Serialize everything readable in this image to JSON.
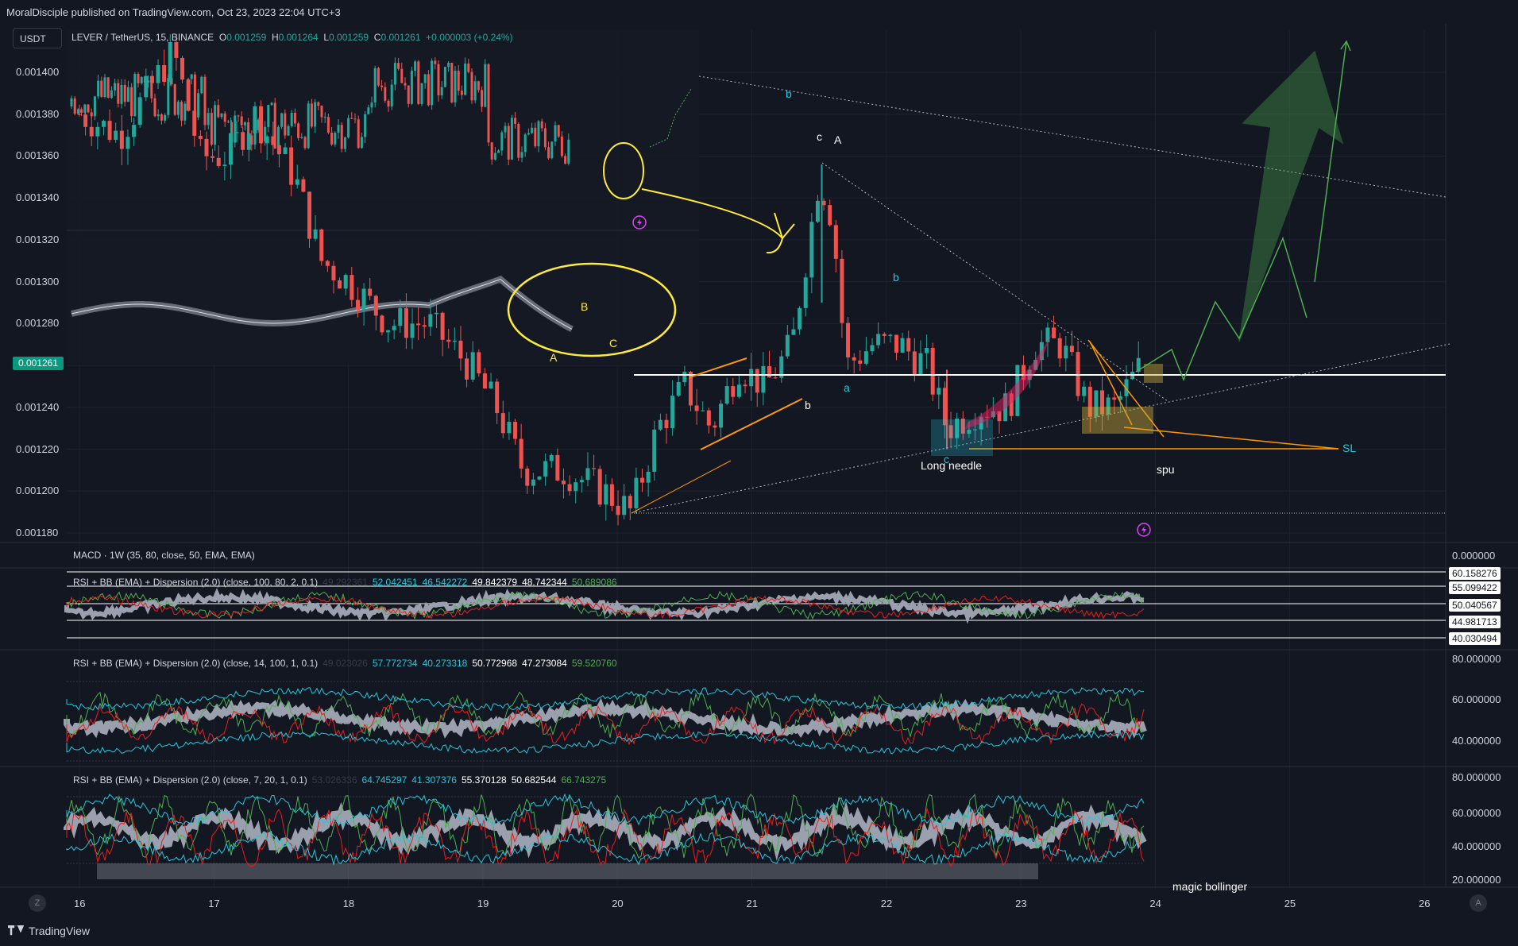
{
  "header": {
    "published": "MoralDisciple published on TradingView.com, Oct 23, 2023 22:04 UTC+3",
    "quote_button": "USDT"
  },
  "legend": {
    "symbol": "LEVER / TetherUS, 15, BINANCE",
    "o_label": "O",
    "o": "0.001259",
    "h_label": "H",
    "h": "0.001264",
    "l_label": "L",
    "l": "0.001259",
    "c_label": "C",
    "c": "0.001261",
    "change": "+0.000003 (+0.24%)"
  },
  "current_price": "0.001261",
  "colors": {
    "background": "#131722",
    "up": "#26a69a",
    "down": "#ef5350",
    "annotation_yellow": "#ffeb3b",
    "orange": "#ff9800",
    "green_arrow": "#4caf50",
    "rsi_green": "#4caf50",
    "rsi_red": "#e91e1e",
    "band_cyan": "#26c6da"
  },
  "chart_data": [
    {
      "type": "candlestick",
      "title": "LEVER / TetherUS, 15, BINANCE",
      "x_tick_labels": [
        "16",
        "17",
        "18",
        "19",
        "20",
        "21",
        "22",
        "23",
        "24",
        "25",
        "26"
      ],
      "y_tick_labels": [
        "0.001400",
        "0.001380",
        "0.001360",
        "0.001340",
        "0.001320",
        "0.001300",
        "0.001280",
        "0.001260",
        "0.001240",
        "0.001220",
        "0.001200",
        "0.001180"
      ],
      "ylim": [
        0.001178,
        0.001418
      ],
      "close_path": [
        [
          16.0,
          0.00138
        ],
        [
          16.3,
          0.00137
        ],
        [
          16.5,
          0.00139
        ],
        [
          16.7,
          0.00141
        ],
        [
          16.9,
          0.00136
        ],
        [
          17.1,
          0.00136
        ],
        [
          17.3,
          0.00138
        ],
        [
          17.6,
          0.00135
        ],
        [
          17.8,
          0.00131
        ],
        [
          18.0,
          0.0013
        ],
        [
          18.3,
          0.00128
        ],
        [
          18.6,
          0.00128
        ],
        [
          18.9,
          0.00126
        ],
        [
          19.1,
          0.00124
        ],
        [
          19.3,
          0.00121
        ],
        [
          19.6,
          0.00121
        ],
        [
          19.9,
          0.0012
        ],
        [
          20.1,
          0.00119
        ],
        [
          20.3,
          0.00123
        ],
        [
          20.5,
          0.00125
        ],
        [
          20.7,
          0.00123
        ],
        [
          20.9,
          0.00126
        ],
        [
          21.1,
          0.00125
        ],
        [
          21.3,
          0.00127
        ],
        [
          21.5,
          0.00135
        ],
        [
          21.6,
          0.00133
        ],
        [
          21.7,
          0.00126
        ],
        [
          21.9,
          0.00127
        ],
        [
          22.1,
          0.00127
        ],
        [
          22.3,
          0.00126
        ],
        [
          22.45,
          0.00123
        ],
        [
          22.7,
          0.00124
        ],
        [
          22.9,
          0.00124
        ],
        [
          23.1,
          0.00127
        ],
        [
          23.3,
          0.00127
        ],
        [
          23.5,
          0.00124
        ],
        [
          23.7,
          0.00124
        ],
        [
          23.9,
          0.001261
        ]
      ],
      "annotations": [
        "A",
        "B",
        "C",
        "b",
        "c",
        "A",
        "a",
        "b",
        "b",
        "c",
        "Long needle",
        "SL",
        "spu",
        "magic bollinger"
      ]
    },
    {
      "type": "line",
      "title": "MACD · 1W (35, 80, close, 50, EMA, EMA)",
      "y_tick_labels": [
        "0.000000"
      ]
    },
    {
      "type": "line",
      "title": "RSI + BB (EMA) + Dispersion (2.0) (close, 100, 80, 2, 0.1)",
      "values_shown": [
        "49.292361",
        "52.042451",
        "46.542272",
        "49.842379",
        "48.742344",
        "50.689086"
      ],
      "y_tick_labels": [
        "60.158276",
        "55.099422",
        "50.040567",
        "44.981713",
        "40.030494"
      ]
    },
    {
      "type": "line",
      "title": "RSI + BB (EMA) + Dispersion (2.0) (close, 14, 100, 1, 0.1)",
      "values_shown": [
        "49.023026",
        "57.772734",
        "40.273318",
        "50.772968",
        "47.273084",
        "59.520760"
      ],
      "y_tick_labels": [
        "80.000000",
        "60.000000",
        "40.000000"
      ]
    },
    {
      "type": "line",
      "title": "RSI + BB (EMA) + Dispersion (2.0) (close, 7, 20, 1, 0.1)",
      "values_shown": [
        "53.026336",
        "64.745297",
        "41.307376",
        "55.370128",
        "50.682544",
        "66.743275"
      ],
      "y_tick_labels": [
        "80.000000",
        "60.000000",
        "40.000000",
        "20.000000"
      ]
    }
  ],
  "footer": {
    "brand": "TradingView"
  }
}
